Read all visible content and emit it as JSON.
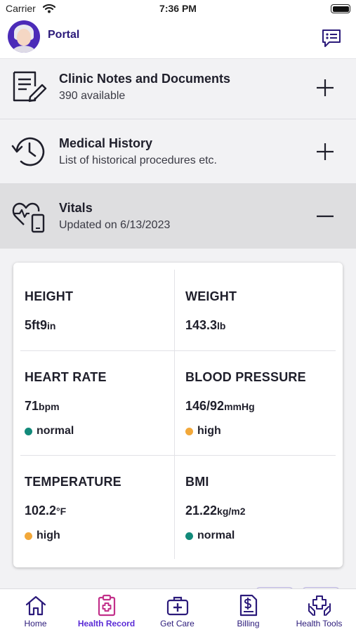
{
  "status_bar": {
    "carrier": "Carrier",
    "time": "7:36 PM"
  },
  "header": {
    "title": "Portal",
    "chat_icon": "chat-bubble-icon"
  },
  "sections": [
    {
      "title": "Clinic Notes and Documents",
      "subtitle": "390 available",
      "icon": "document-edit-icon",
      "toggle": "+"
    },
    {
      "title": "Medical History",
      "subtitle": "List of historical procedures etc.",
      "icon": "history-clock-icon",
      "toggle": "+"
    },
    {
      "title": "Vitals",
      "subtitle": "Updated on 6/13/2023",
      "icon": "heart-device-icon",
      "toggle": "−"
    }
  ],
  "vitals": {
    "height": {
      "label": "HEIGHT",
      "value": "5ft9",
      "unit": "in"
    },
    "weight": {
      "label": "WEIGHT",
      "value": "143.3",
      "unit": "lb"
    },
    "heart_rate": {
      "label": "HEART RATE",
      "value": "71",
      "unit": "bpm",
      "status": "normal",
      "status_color": "#128a7a"
    },
    "blood_pressure": {
      "label": "BLOOD PRESSURE",
      "value": "146/92",
      "unit": "mmHg",
      "status": "high",
      "status_color": "#f2a83a"
    },
    "temperature": {
      "label": "TEMPERATURE",
      "value": "102.2",
      "unit": "°F",
      "status": "high",
      "status_color": "#f2a83a"
    },
    "bmi": {
      "label": "BMI",
      "value": "21.22",
      "unit": "kg/m2",
      "status": "normal",
      "status_color": "#128a7a"
    }
  },
  "tabs": [
    {
      "label": "Home",
      "icon": "home-icon",
      "active": false
    },
    {
      "label": "Health Record",
      "icon": "clipboard-medical-icon",
      "active": true
    },
    {
      "label": "Get Care",
      "icon": "medical-kit-icon",
      "active": false
    },
    {
      "label": "Billing",
      "icon": "invoice-dollar-icon",
      "active": false
    },
    {
      "label": "Health Tools",
      "icon": "hands-plus-icon",
      "active": false
    }
  ],
  "colors": {
    "brand_dark": "#2b1a7a",
    "active_tab": "#5b2bd6",
    "status_normal": "#128a7a",
    "status_high": "#f2a83a"
  }
}
